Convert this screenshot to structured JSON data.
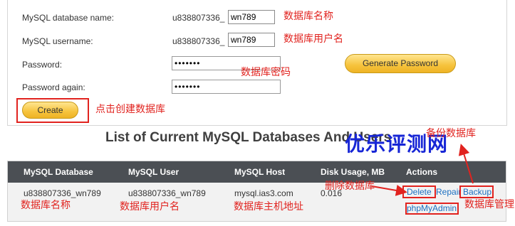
{
  "form": {
    "db_name_label": "MySQL database name:",
    "db_name_prefix": "u838807336_",
    "db_name_value": "wn789",
    "db_name_note": "数据库名称",
    "username_label": "MySQL username:",
    "username_prefix": "u838807336_",
    "username_value": "wn789",
    "username_note": "数据库用户名",
    "password_label": "Password:",
    "password_value": "•••••••",
    "password_note": "数据库密码",
    "password_again_label": "Password again:",
    "password_again_value": "•••••••",
    "generate_button": "Generate Password",
    "create_button": "Create",
    "create_note": "点击创建数据库"
  },
  "list": {
    "title": "List of Current MySQL Databases And Users",
    "watermark": "优乐评测网",
    "backup_note": "备份数据库",
    "columns": [
      "MySQL Database",
      "MySQL User",
      "MySQL Host",
      "Disk Usage, MB",
      "Actions"
    ],
    "row": {
      "database": "u838807336_wn789",
      "user": "u838807336_wn789",
      "host": "mysql.ias3.com",
      "disk": "0.016",
      "delete": "Delete",
      "repair": "Repair",
      "backup": "Backup",
      "phpmyadmin": "phpMyAdmin"
    },
    "notes": {
      "database": "数据库名称",
      "user": "数据库用户名",
      "host": "数据库主机地址",
      "delete": "删除数据库",
      "manage": "数据库管理"
    }
  },
  "colors": {
    "annotation": "#e1231f",
    "header_bg": "#4b4f54",
    "button_gold": "#f6c33c",
    "watermark": "#1726d6",
    "link": "#1a6fc1"
  }
}
